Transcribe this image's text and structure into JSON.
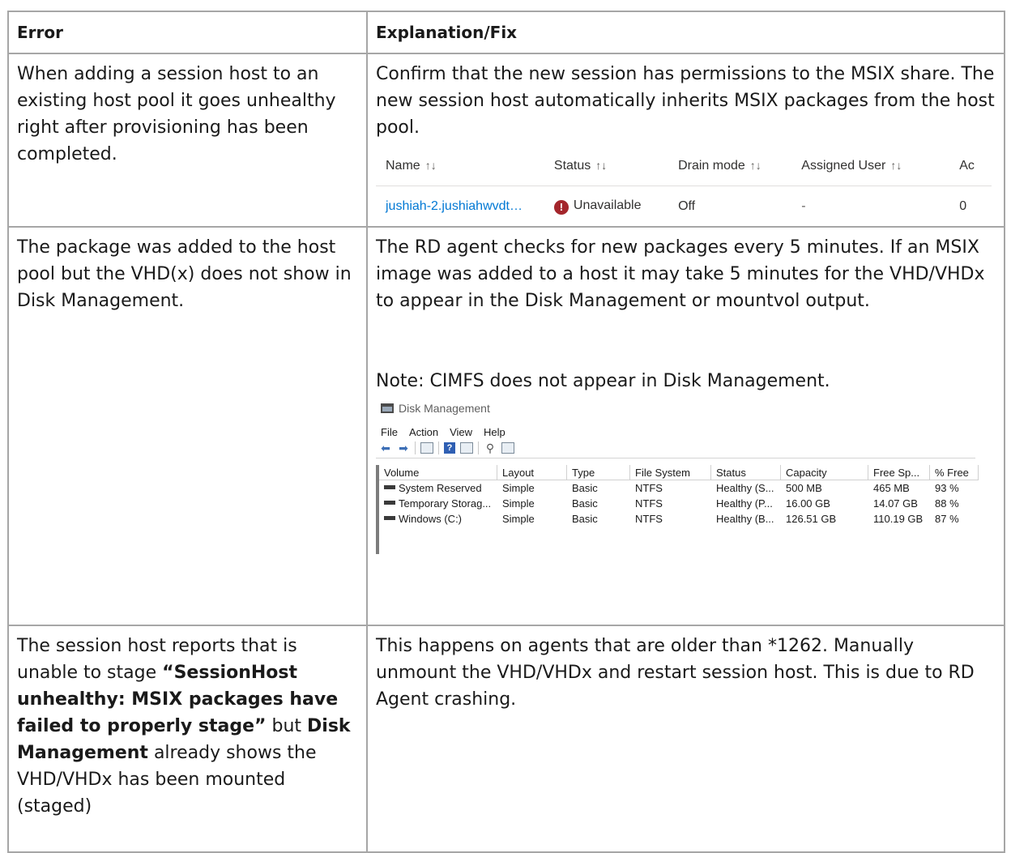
{
  "table": {
    "headers": {
      "error": "Error",
      "fix": "Explanation/Fix"
    },
    "row1": {
      "error": "When adding a session host to an existing host pool it goes unhealthy right after provisioning has been completed.",
      "fix": "Confirm that the new session has permissions to the MSIX share. The new session host automatically inherits MSIX packages from the host pool."
    },
    "row2": {
      "error": "The package was added to the host pool but the VHD(x) does not show in Disk Management.",
      "fix": "The RD agent checks for new packages every 5 minutes. If an MSIX image was added to a host it may take 5 minutes for the VHD/VHDx to appear in the Disk Management or mountvol output.",
      "note": "Note: CIMFS does not appear in Disk Management."
    },
    "row3": {
      "error_part1": "The session host reports that is unable to stage ",
      "error_bold1": "“SessionHost unhealthy: MSIX packages have failed to properly stage”",
      "error_part2": " but ",
      "error_bold2": "Disk Management",
      "error_part3": " already shows the VHD/VHDx has been mounted (staged)",
      "fix": "This happens on agents that are older than *1262. Manually unmount the VHD/VHDx and restart session host. This is due to RD Agent crashing."
    }
  },
  "hostpool": {
    "columns": [
      "Name",
      "Status",
      "Drain mode",
      "Assigned User",
      "Ac"
    ],
    "sort_glyph": "↑↓",
    "row": {
      "name": "jushiah-2.jushiahwvdt…",
      "status": "Unavailable",
      "drain": "Off",
      "user": "-",
      "active": "0"
    },
    "status_icon": "error-icon",
    "status_color": "#a4262c",
    "link_color": "#0078d4"
  },
  "diskmgmt": {
    "title": "Disk Management",
    "menu": [
      "File",
      "Action",
      "View",
      "Help"
    ],
    "columns": [
      "Volume",
      "Layout",
      "Type",
      "File System",
      "Status",
      "Capacity",
      "Free Sp...",
      "% Free"
    ],
    "rows": [
      [
        "System Reserved",
        "Simple",
        "Basic",
        "NTFS",
        "Healthy (S...",
        "500 MB",
        "465 MB",
        "93 %"
      ],
      [
        "Temporary Storag...",
        "Simple",
        "Basic",
        "NTFS",
        "Healthy (P...",
        "16.00 GB",
        "14.07 GB",
        "88 %"
      ],
      [
        "Windows (C:)",
        "Simple",
        "Basic",
        "NTFS",
        "Healthy (B...",
        "126.51 GB",
        "110.19 GB",
        "87 %"
      ]
    ]
  }
}
